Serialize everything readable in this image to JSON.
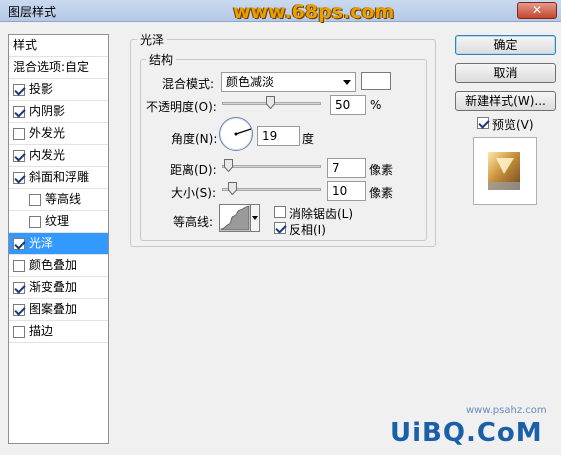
{
  "window": {
    "title": "图层样式",
    "watermark": "www.68ps.com",
    "close_label": "✕"
  },
  "left_panel": {
    "items": [
      {
        "label": "样式",
        "kind": "header"
      },
      {
        "label": "混合选项:自定",
        "kind": "blend"
      },
      {
        "label": "投影",
        "checked": true
      },
      {
        "label": "内阴影",
        "checked": true
      },
      {
        "label": "外发光",
        "checked": false
      },
      {
        "label": "内发光",
        "checked": true
      },
      {
        "label": "斜面和浮雕",
        "checked": true
      },
      {
        "label": "等高线",
        "checked": false,
        "indent": true
      },
      {
        "label": "纹理",
        "checked": false,
        "indent": true
      },
      {
        "label": "光泽",
        "checked": true,
        "selected": true
      },
      {
        "label": "颜色叠加",
        "checked": false
      },
      {
        "label": "渐变叠加",
        "checked": true
      },
      {
        "label": "图案叠加",
        "checked": true
      },
      {
        "label": "描边",
        "checked": false
      }
    ]
  },
  "satin": {
    "group_title": "光泽",
    "structure_title": "结构",
    "blend_mode_label": "混合模式:",
    "blend_mode_value": "颜色减淡",
    "blend_color": "#ffffff",
    "opacity_label": "不透明度(O):",
    "opacity_value": "50",
    "opacity_unit": "%",
    "angle_label": "角度(N):",
    "angle_value": "19",
    "angle_unit": "度",
    "distance_label": "距离(D):",
    "distance_value": "7",
    "distance_unit": "像素",
    "size_label": "大小(S):",
    "size_value": "10",
    "size_unit": "像素",
    "contour_label": "等高线:",
    "antialias_label": "消除锯齿(L)",
    "antialias_checked": false,
    "invert_label": "反相(I)",
    "invert_checked": true
  },
  "buttons": {
    "ok": "确定",
    "cancel": "取消",
    "new_style": "新建样式(W)...",
    "preview_label": "预览(V)",
    "preview_checked": true
  },
  "footer": {
    "logo_text": "UiBQ.CoM",
    "small_url": "www.psahz.com"
  },
  "colors": {
    "selection": "#3399ff",
    "primary_button_border": "#3c7fb1"
  }
}
